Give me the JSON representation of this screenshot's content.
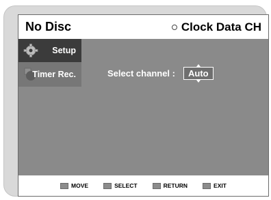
{
  "header": {
    "title": "No Disc",
    "right_label": "Clock Data CH",
    "icon": "clock-circle-icon"
  },
  "sidebar": {
    "items": [
      {
        "label": "Setup",
        "icon": "gear-icon",
        "active": true
      },
      {
        "label": "Timer Rec.",
        "icon": "timer-icon",
        "active": false
      }
    ]
  },
  "main": {
    "select_label": "Select channel :",
    "select_value": "Auto"
  },
  "footer": {
    "items": [
      {
        "label": "MOVE",
        "icon": "updown-icon"
      },
      {
        "label": "SELECT",
        "icon": "enter-icon"
      },
      {
        "label": "RETURN",
        "icon": "return-icon"
      },
      {
        "label": "EXIT",
        "icon": "exit-icon"
      }
    ]
  },
  "colors": {
    "screen_bg": "#8a8a8a",
    "header_bg": "#ffffff",
    "active_item_bg": "#3b3b3b"
  }
}
